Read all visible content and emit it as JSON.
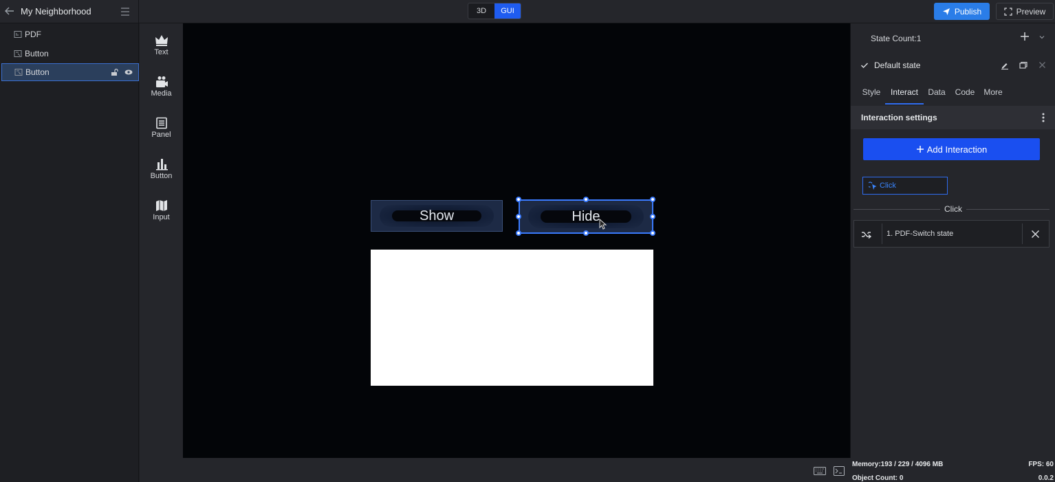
{
  "header": {
    "project_title": "My Neighborhood",
    "mode_3d": "3D",
    "mode_gui": "GUI",
    "publish_label": "Publish",
    "preview_label": "Preview"
  },
  "layers": [
    {
      "label": "PDF",
      "selected": false
    },
    {
      "label": "Button",
      "selected": false
    },
    {
      "label": "Button",
      "selected": true
    }
  ],
  "components": [
    {
      "label": "Text",
      "icon": "crown-icon"
    },
    {
      "label": "Media",
      "icon": "camera-icon"
    },
    {
      "label": "Panel",
      "icon": "panel-icon"
    },
    {
      "label": "Button",
      "icon": "bar-chart-icon"
    },
    {
      "label": "Input",
      "icon": "map-icon"
    }
  ],
  "canvas": {
    "show_button_label": "Show",
    "hide_button_label": "Hide"
  },
  "right_panel": {
    "state_count": "State Count:1",
    "default_state": "Default state",
    "tabs": [
      "Style",
      "Interact",
      "Data",
      "Code",
      "More"
    ],
    "active_tab": "Interact",
    "section_title": "Interaction settings",
    "add_interaction_label": "Add Interaction",
    "trigger_value": "Click",
    "group_label": "Click",
    "action_label": "1. PDF-Switch state"
  },
  "status": {
    "memory": "Memory:193 / 229 / 4096 MB",
    "object_count": "Object Count: 0",
    "fps": "FPS: 60",
    "version": "0.0.2"
  },
  "colors": {
    "accent": "#1f5cf0",
    "publish": "#2a7de8",
    "canvas_bg": "#030508",
    "selection": "#3a7bff"
  }
}
